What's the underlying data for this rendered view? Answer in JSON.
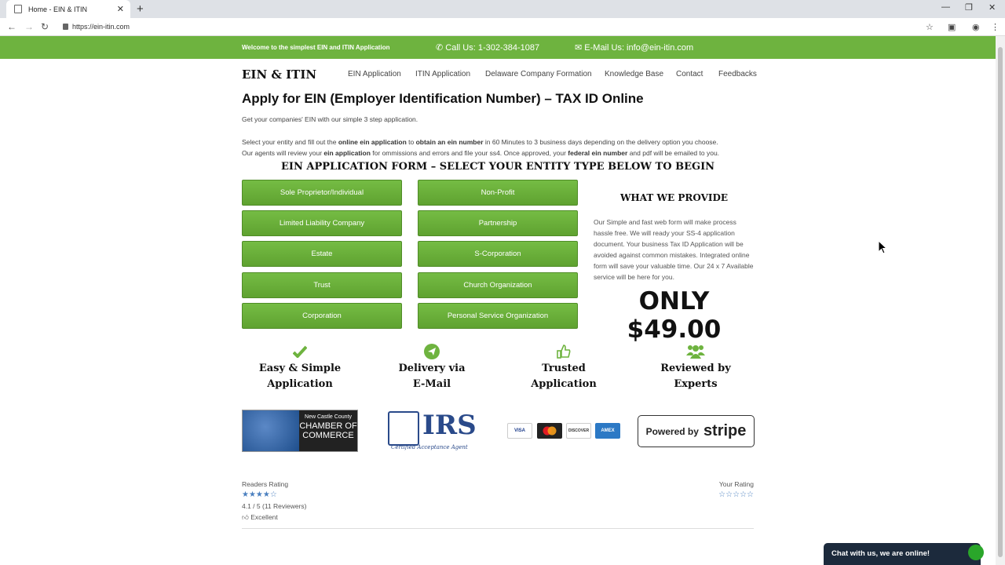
{
  "browser": {
    "tab_title": "Home - EIN & ITIN",
    "url": "https://ein-itin.com"
  },
  "topbar": {
    "welcome": "Welcome to the simplest EIN and ITIN Application",
    "call": "Call Us: 1-302-384-1087",
    "email": "E-Mail Us: info@ein-itin.com"
  },
  "nav": {
    "logo": "EIN & ITIN",
    "items": [
      "EIN Application",
      "ITIN Application",
      "Delaware Company Formation",
      "Knowledge Base",
      "Contact",
      "Feedbacks"
    ]
  },
  "main": {
    "title": "Apply for EIN (Employer Identification Number) – TAX ID Online",
    "subtitle": "Get your companies' EIN  with our simple 3 step application.",
    "para1_a": "Select your entity and fill out the ",
    "para1_b": "online ein application",
    "para1_c": " to ",
    "para1_d": "obtain an ein number",
    "para1_e": " in 60 Minutes to 3 business days depending on the delivery option you choose.",
    "para2_a": "Our agents will review your ",
    "para2_b": "ein application",
    "para2_c": " for ommissions and errors and file your ss4. Once approved, your ",
    "para2_d": "federal ein number",
    "para2_e": " and pdf will be emailed to you.",
    "form_title": "EIN APPLICATION FORM – SELECT YOUR ENTITY TYPE BELOW TO BEGIN"
  },
  "entities": [
    "Sole Proprietor/Individual",
    "Non-Profit",
    "Limited Liability Company",
    "Partnership",
    "Estate",
    "S-Corporation",
    "Trust",
    "Church Organization",
    "Corporation",
    "Personal Service Organization"
  ],
  "provide": {
    "title": "WHAT WE PROVIDE",
    "text": "Our Simple and fast web form will make process hassle free. We will ready your SS-4 application document. Your business Tax ID Application will be avoided against common mistakes. Integrated online form will save your valuable time. Our 24 x 7 Available service will be here for you.",
    "price": "ONLY $49.00"
  },
  "features": [
    {
      "l1": "Easy & Simple",
      "l2": "Application",
      "icon": "check-icon"
    },
    {
      "l1": "Delivery via",
      "l2": "E-Mail",
      "icon": "paper-plane-icon"
    },
    {
      "l1": "Trusted",
      "l2": "Application",
      "icon": "thumbs-up-icon"
    },
    {
      "l1": "Reviewed by",
      "l2": "Experts",
      "icon": "users-icon"
    }
  ],
  "logos": {
    "chamber_small": "New Castle County",
    "chamber_l1": "CHAMBER OF",
    "chamber_l2": "COMMERCE",
    "irs": "IRS",
    "irs_sub": "Certified Acceptance Agent",
    "cards": [
      "VISA",
      "MC",
      "DISCOVER",
      "AMEX"
    ],
    "stripe_pb": "Powered by",
    "stripe_word": "stripe"
  },
  "rating": {
    "readers_label": "Readers Rating",
    "readers_stars": "★★★★☆",
    "score": "4.1 / 5 (11 Reviewers)",
    "verdict": "Excellent",
    "your_label": "Your Rating",
    "your_stars": "☆☆☆☆☆"
  },
  "chat": {
    "text": "Chat with us, we are online!"
  },
  "colors": {
    "brand_green": "#6eb33f",
    "chat_bg": "#1c2a3c"
  }
}
